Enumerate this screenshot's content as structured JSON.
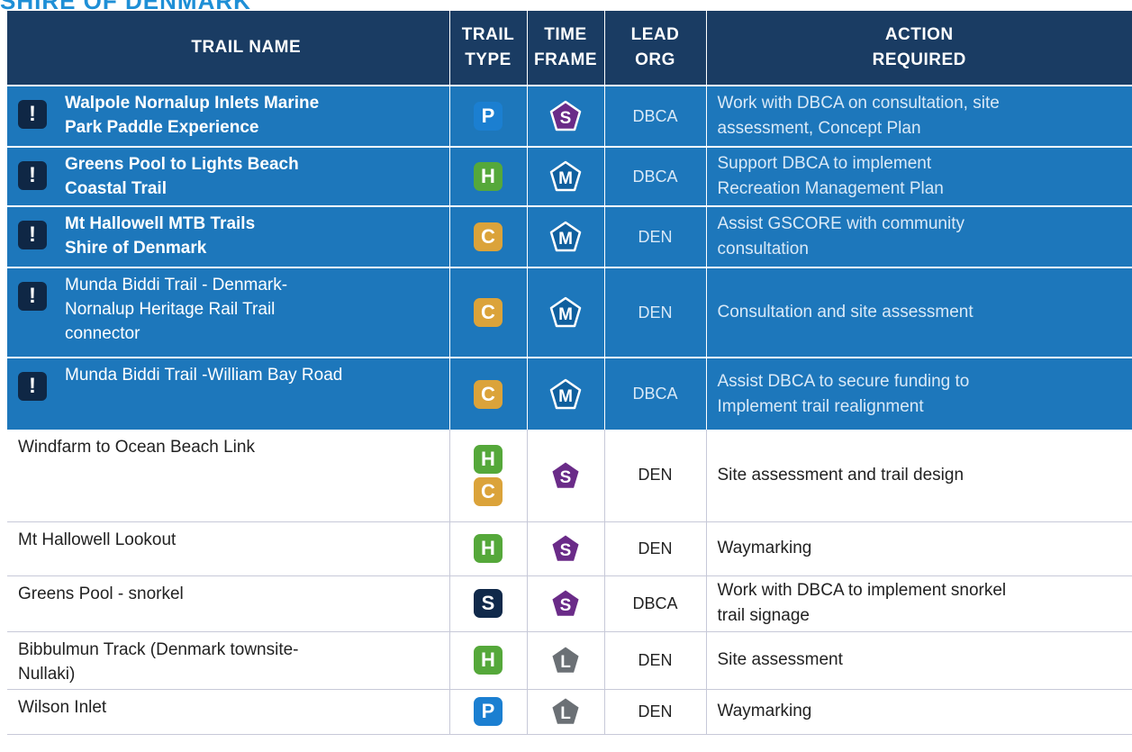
{
  "page_title": "SHIRE OF DENMARK",
  "headers": {
    "trail_name": "TRAIL NAME",
    "trail_type": [
      "TRAIL",
      "TYPE"
    ],
    "time_frame": [
      "TIME",
      "FRAME"
    ],
    "lead_org": [
      "LEAD",
      "ORG"
    ],
    "action": [
      "ACTION",
      "REQUIRED"
    ]
  },
  "priority_icon": "!",
  "rows": [
    {
      "name_lines": [
        "Walpole Nornalup Inlets Marine",
        "Park Paddle Experience"
      ],
      "priority": true,
      "bold": true,
      "type": [
        "P"
      ],
      "type_colors": [
        "#1b7fd1"
      ],
      "time": "S",
      "org": "DBCA",
      "action_lines": [
        "Work with DBCA on consultation, site",
        "assessment, Concept Plan"
      ]
    },
    {
      "name_lines": [
        "Greens Pool to Lights Beach",
        "Coastal Trail"
      ],
      "priority": true,
      "bold": true,
      "type": [
        "H"
      ],
      "type_colors": [
        "#55a83a"
      ],
      "time": "M",
      "org": "DBCA",
      "action_lines": [
        "Support DBCA to implement",
        "Recreation Management Plan"
      ]
    },
    {
      "name_lines": [
        "Mt Hallowell MTB Trails",
        "Shire of Denmark"
      ],
      "priority": true,
      "bold": true,
      "type": [
        "C"
      ],
      "type_colors": [
        "#dba33a"
      ],
      "time": "M",
      "org": "DEN",
      "action_lines": [
        "Assist GSCORE with community",
        "consultation"
      ]
    },
    {
      "name_lines": [
        "Munda Biddi Trail - Denmark-",
        "Nornalup Heritage Rail Trail",
        "connector"
      ],
      "priority": true,
      "bold": false,
      "type": [
        "C"
      ],
      "type_colors": [
        "#dba33a"
      ],
      "time": "M",
      "org": "DEN",
      "action_lines": [
        "Consultation and site assessment"
      ]
    },
    {
      "name_lines": [
        "Munda Biddi Trail -William Bay Road"
      ],
      "priority": true,
      "bold": false,
      "type": [
        "C"
      ],
      "type_colors": [
        "#dba33a"
      ],
      "time": "M",
      "org": "DBCA",
      "action_lines": [
        "Assist DBCA to secure funding to",
        "Implement trail realignment"
      ]
    },
    {
      "name_lines": [
        "Windfarm to Ocean Beach Link"
      ],
      "priority": false,
      "type": [
        "H",
        "C"
      ],
      "type_colors": [
        "#55a83a",
        "#dba33a"
      ],
      "time": "S",
      "org": "DEN",
      "action_lines": [
        "Site assessment and trail design"
      ]
    },
    {
      "name_lines": [
        "Mt Hallowell Lookout"
      ],
      "priority": false,
      "type": [
        "H"
      ],
      "type_colors": [
        "#55a83a"
      ],
      "time": "S",
      "org": "DEN",
      "action_lines": [
        "Waymarking"
      ]
    },
    {
      "name_lines": [
        "Greens Pool - snorkel"
      ],
      "priority": false,
      "type": [
        "S"
      ],
      "type_colors": [
        "#10294a"
      ],
      "time": "S",
      "org": "DBCA",
      "action_lines": [
        "Work with DBCA to implement snorkel",
        "trail signage"
      ]
    },
    {
      "name_lines": [
        "Bibbulmun Track (Denmark townsite-",
        "Nullaki)"
      ],
      "priority": false,
      "type": [
        "H"
      ],
      "type_colors": [
        "#55a83a"
      ],
      "time": "L",
      "org": "DEN",
      "action_lines": [
        "Site assessment"
      ]
    },
    {
      "name_lines": [
        "Wilson Inlet"
      ],
      "priority": false,
      "type": [
        "P"
      ],
      "type_colors": [
        "#1b7fd1"
      ],
      "time": "L",
      "org": "DEN",
      "action_lines": [
        "Waymarking"
      ]
    }
  ],
  "time_frame_colors": {
    "S": "#6a2b88",
    "M": "#0f5f9e",
    "L": "#6b7075"
  }
}
